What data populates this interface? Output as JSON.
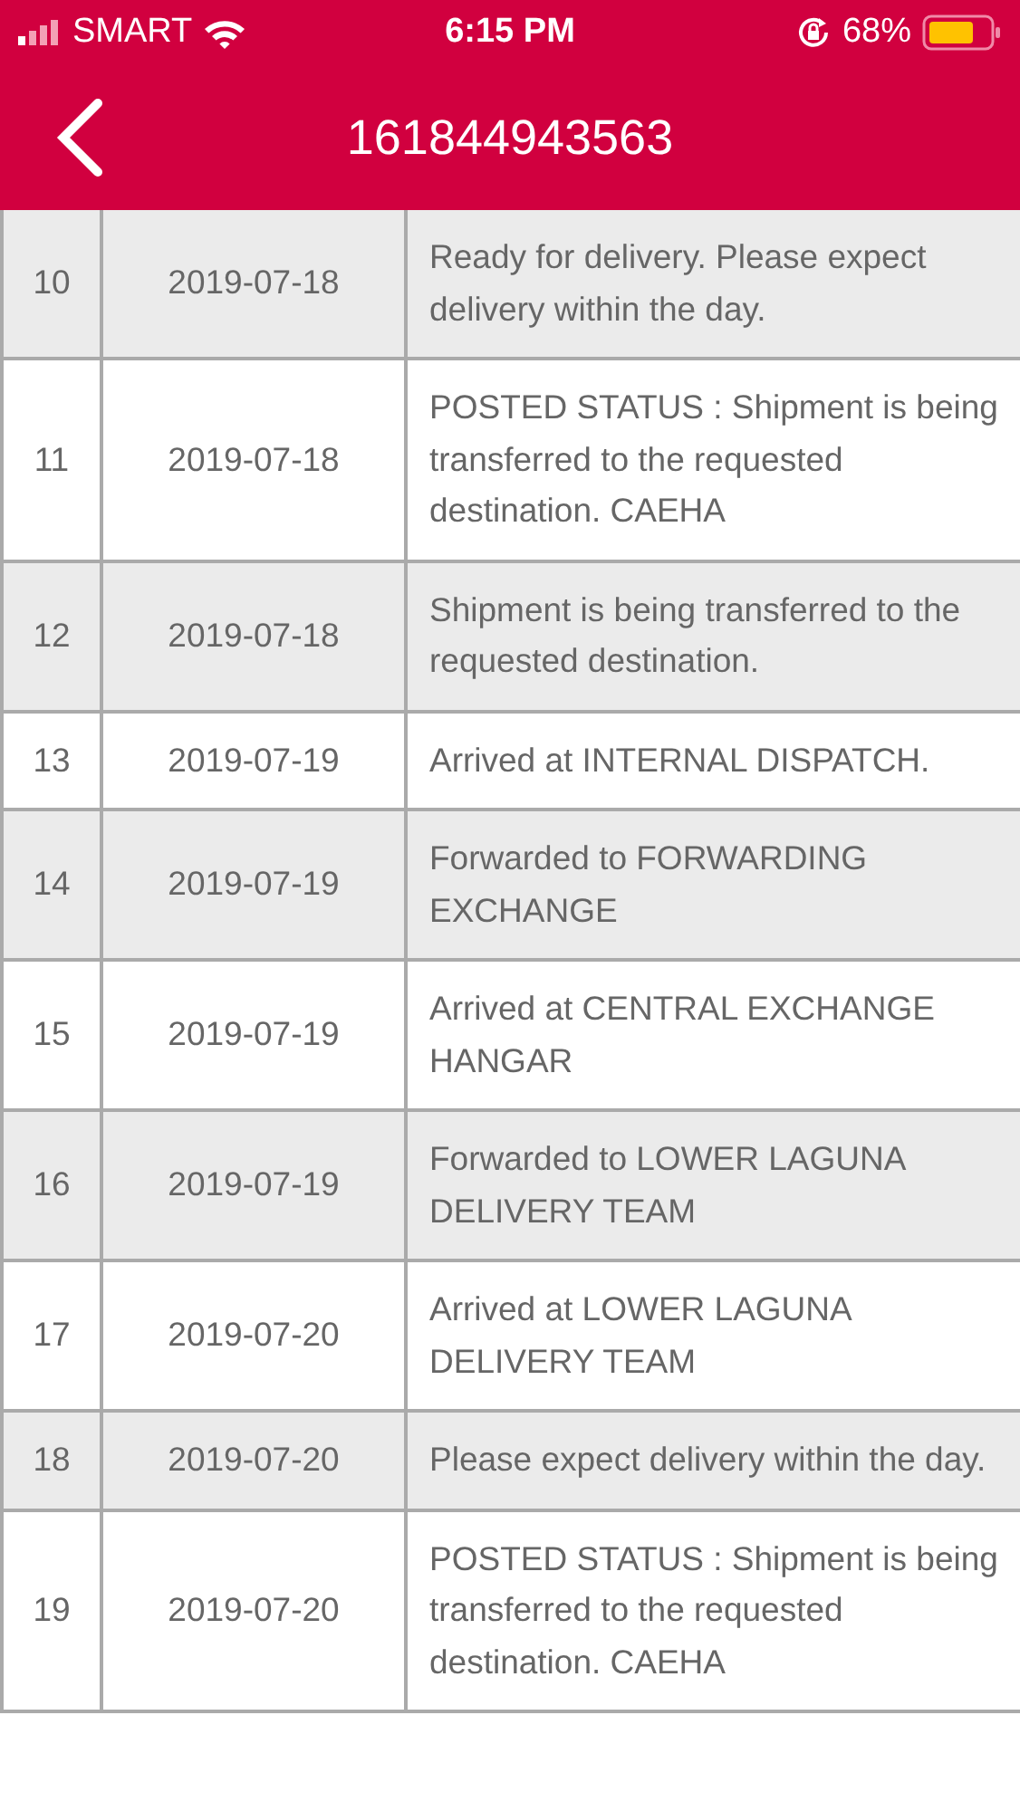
{
  "status_bar": {
    "carrier": "SMART",
    "time": "6:15 PM",
    "battery": "68%"
  },
  "nav": {
    "title": "161844943563"
  },
  "rows": [
    {
      "no": "10",
      "date": "2019-07-18",
      "status": "Ready for delivery. Please expect delivery within the day."
    },
    {
      "no": "11",
      "date": "2019-07-18",
      "status": "POSTED STATUS : Shipment is being transferred to the requested destination. CAEHA"
    },
    {
      "no": "12",
      "date": "2019-07-18",
      "status": "Shipment is being transferred to the requested destination."
    },
    {
      "no": "13",
      "date": "2019-07-19",
      "status": "Arrived at INTERNAL DISPATCH."
    },
    {
      "no": "14",
      "date": "2019-07-19",
      "status": "Forwarded to FORWARDING EXCHANGE"
    },
    {
      "no": "15",
      "date": "2019-07-19",
      "status": "Arrived at CENTRAL EXCHANGE HANGAR"
    },
    {
      "no": "16",
      "date": "2019-07-19",
      "status": "Forwarded to LOWER LAGUNA DELIVERY TEAM"
    },
    {
      "no": "17",
      "date": "2019-07-20",
      "status": "Arrived at LOWER LAGUNA DELIVERY TEAM"
    },
    {
      "no": "18",
      "date": "2019-07-20",
      "status": "Please expect delivery within the day."
    },
    {
      "no": "19",
      "date": "2019-07-20",
      "status": "POSTED STATUS : Shipment is being transferred to the requested destination. CAEHA"
    }
  ]
}
